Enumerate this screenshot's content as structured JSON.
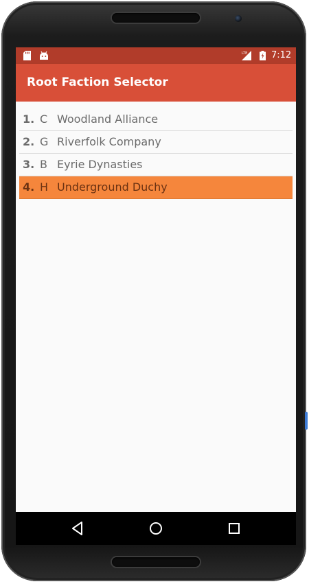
{
  "statusbar": {
    "icons": [
      "sd-card-icon",
      "android-icon",
      "lte-signal-icon",
      "battery-charging-icon"
    ],
    "network_label": "LTE",
    "time": "7:12"
  },
  "appbar": {
    "title": "Root Faction Selector"
  },
  "factions": [
    {
      "number": "1.",
      "letter": "C",
      "name": "Woodland Alliance",
      "selected": false
    },
    {
      "number": "2.",
      "letter": "G",
      "name": "Riverfolk Company",
      "selected": false
    },
    {
      "number": "3.",
      "letter": "B",
      "name": "Eyrie Dynasties",
      "selected": false
    },
    {
      "number": "4.",
      "letter": "H",
      "name": "Underground Duchy",
      "selected": true
    }
  ],
  "navbar": {
    "buttons": [
      "back-icon",
      "home-icon",
      "recents-icon"
    ]
  },
  "colors": {
    "statusbar": "#b13c2a",
    "appbar": "#d84f38",
    "selected_row": "#f5863c",
    "background": "#fafafa"
  }
}
